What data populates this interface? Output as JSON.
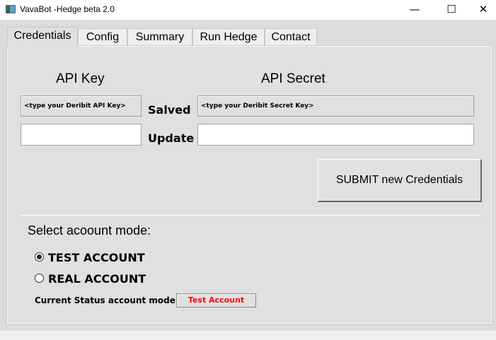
{
  "window": {
    "title": "VavaBot -Hedge beta 2.0",
    "minimize_icon": "minimize-icon",
    "maximize_icon": "maximize-icon",
    "close_icon": "close-icon"
  },
  "tabs": [
    {
      "label": "Credentials",
      "active": true
    },
    {
      "label": "Config"
    },
    {
      "label": "Summary"
    },
    {
      "label": "Run Hedge"
    },
    {
      "label": "Contact"
    }
  ],
  "credentials": {
    "api_key_label": "API Key",
    "api_secret_label": "API Secret",
    "saved_label": "Salved",
    "update_label": "Update",
    "saved_api_key": "<type your Deribit API Key>",
    "saved_api_secret": "<type your Deribit Secret Key>",
    "new_api_key": "",
    "new_api_secret": "",
    "submit_label": "SUBMIT new Credentials"
  },
  "account_mode": {
    "heading": "Select acoount mode:",
    "options": [
      {
        "label": "TEST ACCOUNT",
        "selected": true
      },
      {
        "label": "REAL ACCOUNT",
        "selected": false
      }
    ],
    "status_label": "Current Status account mode",
    "status_value": "Test Account",
    "status_color": "#ff0000"
  }
}
